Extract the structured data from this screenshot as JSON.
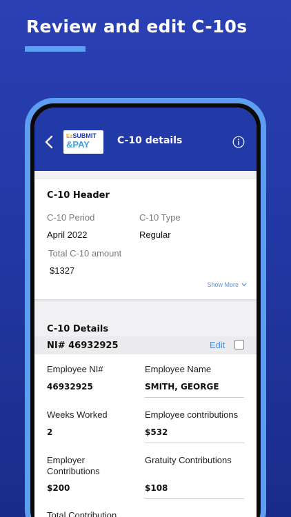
{
  "promo": {
    "title": "Review and edit C-10s"
  },
  "header": {
    "logo": {
      "ez": "Ez",
      "submit": "SUBMIT",
      "pay": "&PAY"
    },
    "title": "C-10 details",
    "icons": {
      "back": "chevron-left-icon",
      "info": "info-icon"
    }
  },
  "c10_header": {
    "title": "C-10 Header",
    "period_label": "C-10 Period",
    "period_value": "April 2022",
    "type_label": "C-10 Type",
    "type_value": "Regular",
    "total_label": "Total C-10 amount",
    "total_value": "$1327",
    "show_more": "Show More"
  },
  "c10_details": {
    "title": "C-10 Details",
    "ni_row": {
      "label": "NI# 46932925",
      "edit": "Edit"
    },
    "fields": {
      "employee_ni_label": "Employee NI#",
      "employee_ni_value": "46932925",
      "employee_name_label": "Employee Name",
      "employee_name_value": "SMITH, GEORGE",
      "weeks_worked_label": "Weeks Worked",
      "weeks_worked_value": "2",
      "employee_contrib_label": "Employee contributions",
      "employee_contrib_value": "$532",
      "employer_contrib_label_1": "Employer",
      "employer_contrib_label_2": "Contributions",
      "employer_contrib_value": "$200",
      "gratuity_label": "Gratuity Contributions",
      "gratuity_value": "$108",
      "total_contrib_label": "Total Contribution"
    }
  },
  "colors": {
    "background": "#2a40b4",
    "header": "#2239a8",
    "accent": "#5ea0f4",
    "link": "#4a90e2"
  }
}
